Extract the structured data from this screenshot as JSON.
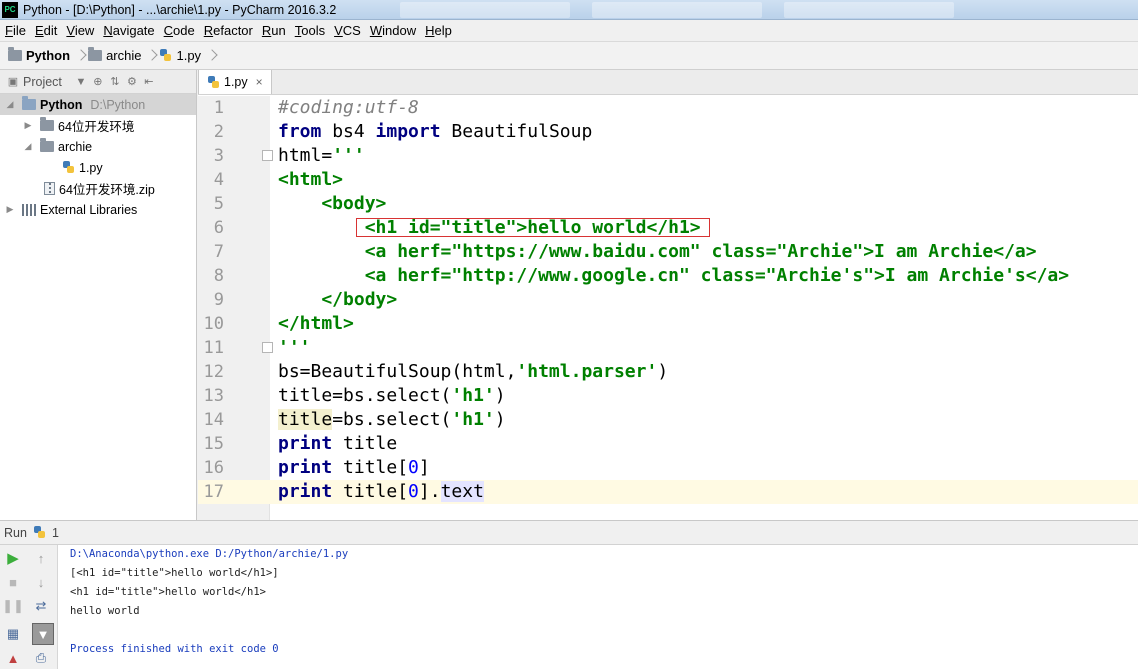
{
  "window": {
    "title": "Python - [D:\\Python] - ...\\archie\\1.py - PyCharm 2016.3.2",
    "logo_text": "PC"
  },
  "menu": [
    "File",
    "Edit",
    "View",
    "Navigate",
    "Code",
    "Refactor",
    "Run",
    "Tools",
    "VCS",
    "Window",
    "Help"
  ],
  "breadcrumb": {
    "items": [
      "Python",
      "archie",
      "1.py"
    ]
  },
  "project_panel": {
    "header_label": "Project",
    "tree": [
      {
        "label": "Python",
        "path": "D:\\Python",
        "level": 0
      },
      {
        "label": "64位开发环境",
        "level": 1
      },
      {
        "label": "archie",
        "level": 1
      },
      {
        "label": "1.py",
        "level": 2
      },
      {
        "label": "64位开发环境.zip",
        "level": 1
      },
      {
        "label": "External Libraries",
        "level": 0
      }
    ]
  },
  "editor": {
    "tab_label": "1.py",
    "tab_close": "×",
    "line_numbers": [
      "1",
      "2",
      "3",
      "4",
      "5",
      "6",
      "7",
      "8",
      "9",
      "10",
      "11",
      "12",
      "13",
      "14",
      "15",
      "16",
      "17"
    ],
    "current_line": 17
  },
  "run_panel": {
    "header_label": "Run",
    "config_number": "1",
    "output": [
      "D:\\Anaconda\\python.exe D:/Python/archie/1.py",
      "[<h1 id=\"title\">hello world</h1>]",
      "<h1 id=\"title\">hello world</h1>",
      "hello world",
      "",
      "Process finished with exit code 0"
    ]
  },
  "colors": {
    "keyword": "#000080",
    "string": "#008000",
    "comment": "#808080",
    "number": "#0000ff",
    "current_line": "#fffae3",
    "highlight_box": "#d83333",
    "run_green": "#3cae3c"
  }
}
